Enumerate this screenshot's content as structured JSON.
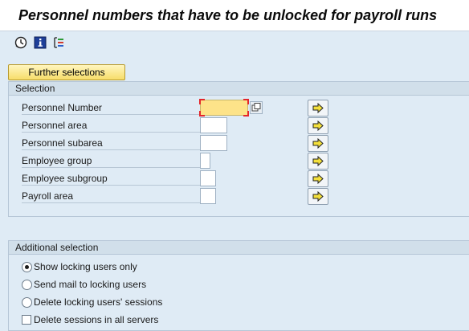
{
  "window": {
    "title": "Personnel numbers that have to be unlocked for payroll runs"
  },
  "toolbar": {
    "icons": [
      "execute-clock-icon",
      "information-icon",
      "selection-options-icon"
    ]
  },
  "further_selections_label": "Further selections",
  "selection": {
    "header": "Selection",
    "fields": [
      {
        "label": "Personnel Number",
        "value": "",
        "active": true
      },
      {
        "label": "Personnel area",
        "value": ""
      },
      {
        "label": "Personnel subarea",
        "value": ""
      },
      {
        "label": "Employee group",
        "value": ""
      },
      {
        "label": "Employee subgroup",
        "value": ""
      },
      {
        "label": "Payroll area",
        "value": ""
      }
    ]
  },
  "additional": {
    "header": "Additional selection",
    "options": [
      {
        "label": "Show locking users only",
        "type": "radio",
        "checked": true
      },
      {
        "label": "Send mail to locking users",
        "type": "radio",
        "checked": false
      },
      {
        "label": "Delete locking users' sessions",
        "type": "radio",
        "checked": false
      },
      {
        "label": "Delete sessions in all servers",
        "type": "checkbox",
        "checked": false
      }
    ]
  },
  "colors": {
    "background": "#dfebf5",
    "active_field": "#fde389",
    "button_yellow": "#f7dd6a",
    "required_marker": "#e3262b"
  }
}
